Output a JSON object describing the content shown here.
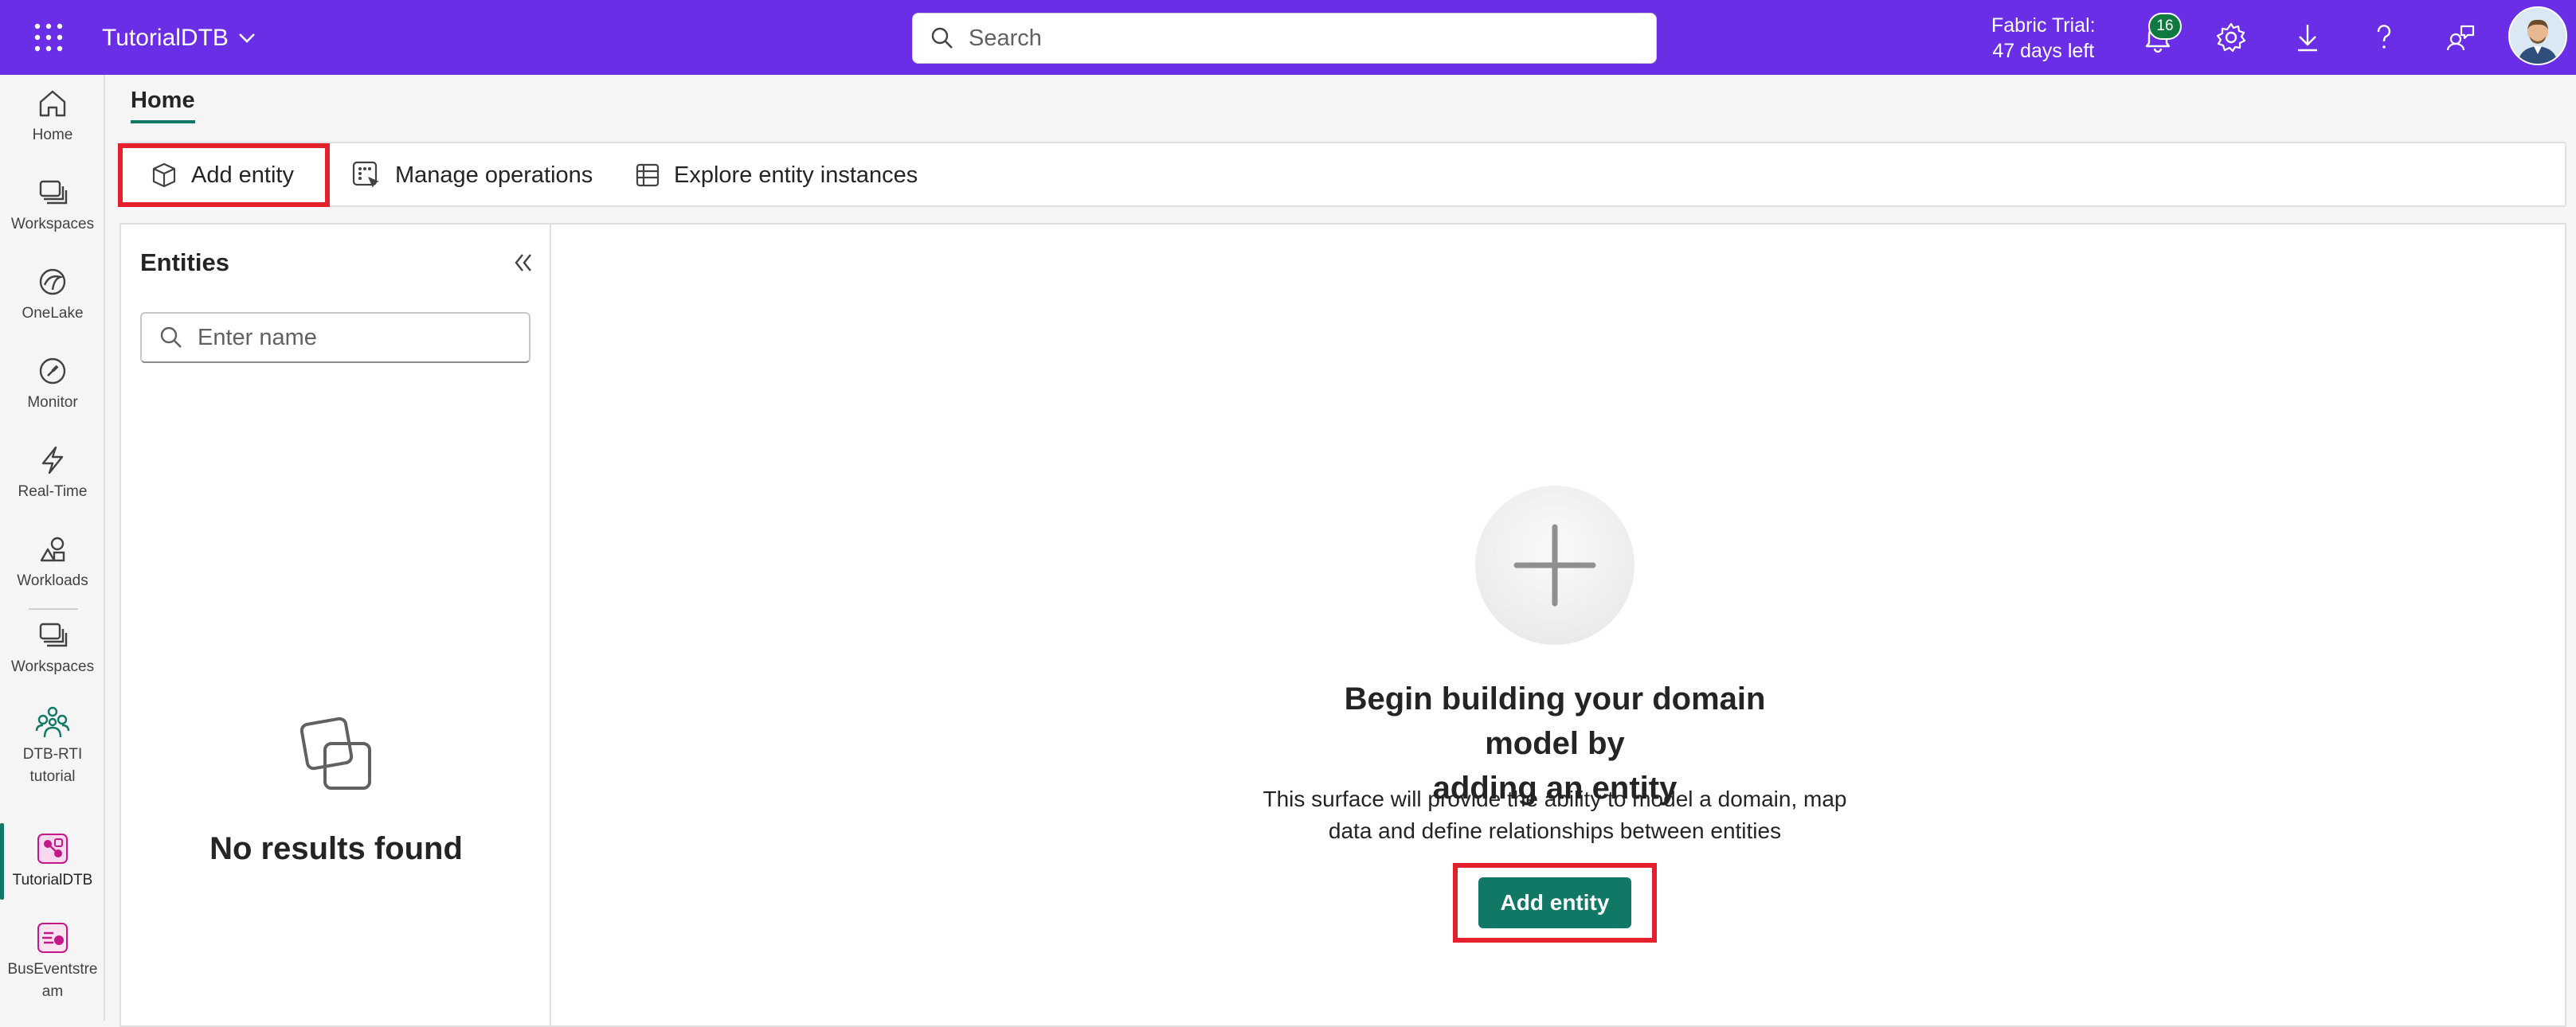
{
  "header": {
    "app_name": "TutorialDTB",
    "search_placeholder": "Search",
    "trial_line1": "Fabric Trial:",
    "trial_line2": "47 days left",
    "notification_count": "16",
    "brand_color": "#6a2ee6"
  },
  "nav": {
    "items": [
      {
        "label": "Home",
        "icon": "home-icon"
      },
      {
        "label": "Workspaces",
        "icon": "workspaces-icon"
      },
      {
        "label": "OneLake",
        "icon": "onelake-icon"
      },
      {
        "label": "Monitor",
        "icon": "monitor-icon"
      },
      {
        "label": "Real-Time",
        "icon": "lightning-icon"
      },
      {
        "label": "Workloads",
        "icon": "workloads-icon"
      },
      {
        "label": "Workspaces",
        "icon": "workspaces-icon"
      },
      {
        "label_line1": "DTB-RTI",
        "label_line2": "tutorial",
        "icon": "people-group-icon"
      },
      {
        "label": "TutorialDTB",
        "icon": "digital-twin-icon",
        "active": true
      },
      {
        "label_line1": "BusEventstre",
        "label_line2": "am",
        "icon": "eventstream-icon"
      }
    ]
  },
  "ribbon": {
    "tab": "Home",
    "add_entity": "Add entity",
    "manage_operations": "Manage operations",
    "explore_instances": "Explore entity instances"
  },
  "entities_panel": {
    "title": "Entities",
    "filter_placeholder": "Enter name",
    "empty_text": "No results found"
  },
  "canvas": {
    "title_line1": "Begin building your domain model by",
    "title_line2": "adding an entity",
    "desc_line1": "This surface will provide the ability to model a domain, map",
    "desc_line2": "data and define relationships between entities",
    "button": "Add entity",
    "accent_color": "#117865"
  },
  "highlight_color": "#e3202c"
}
